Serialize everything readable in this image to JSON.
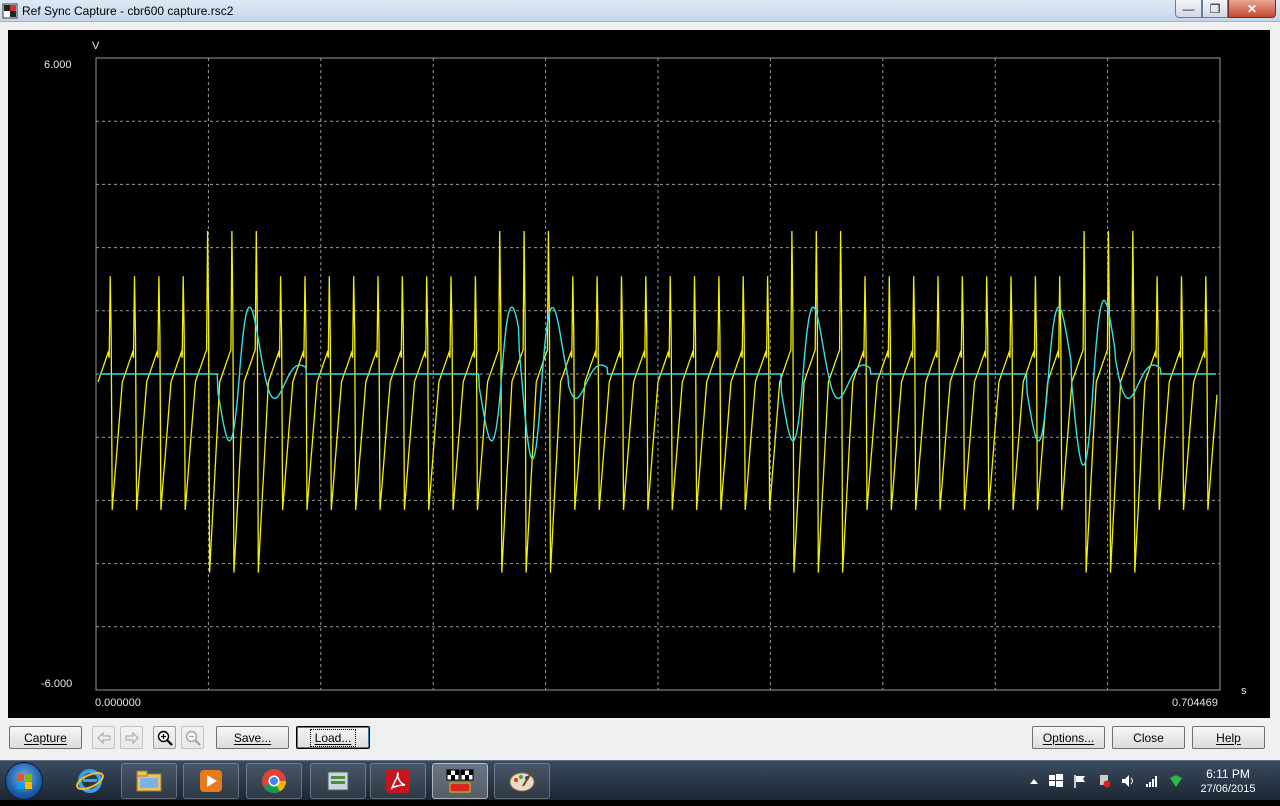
{
  "window": {
    "title": "Ref Sync Capture - cbr600 capture.rsc2",
    "min_glyph": "—",
    "max_glyph": "❐",
    "close_glyph": "✕"
  },
  "plot": {
    "y_unit": "V",
    "x_unit": "s",
    "y_max_label": "6.000",
    "y_min_label": "-6.000",
    "x_min_label": "0.000000",
    "x_max_label": "0.704469",
    "y_range": [
      -6,
      6
    ],
    "x_range": [
      0,
      0.704469
    ],
    "grid": true,
    "background": "#000000",
    "grid_color": "#9a9a9a",
    "series": [
      {
        "color": "#f5f000"
      },
      {
        "color": "#33e0e6"
      }
    ]
  },
  "buttons": {
    "capture": "Capture",
    "save": "Save...",
    "load": "Load...",
    "options": "Options...",
    "close": "Close",
    "help": "Help"
  },
  "icons": {
    "prev": "left-arrow-icon",
    "next": "right-arrow-icon",
    "zoom_in": "zoom-in-icon",
    "zoom_out": "zoom-out-icon"
  },
  "taskbar": {
    "time": "6:11 PM",
    "date": "27/06/2015",
    "apps": [
      "internet-explorer",
      "file-explorer",
      "media-player",
      "chrome",
      "file-manager",
      "adobe-reader",
      "ref-sync-capture",
      "paint"
    ]
  }
}
